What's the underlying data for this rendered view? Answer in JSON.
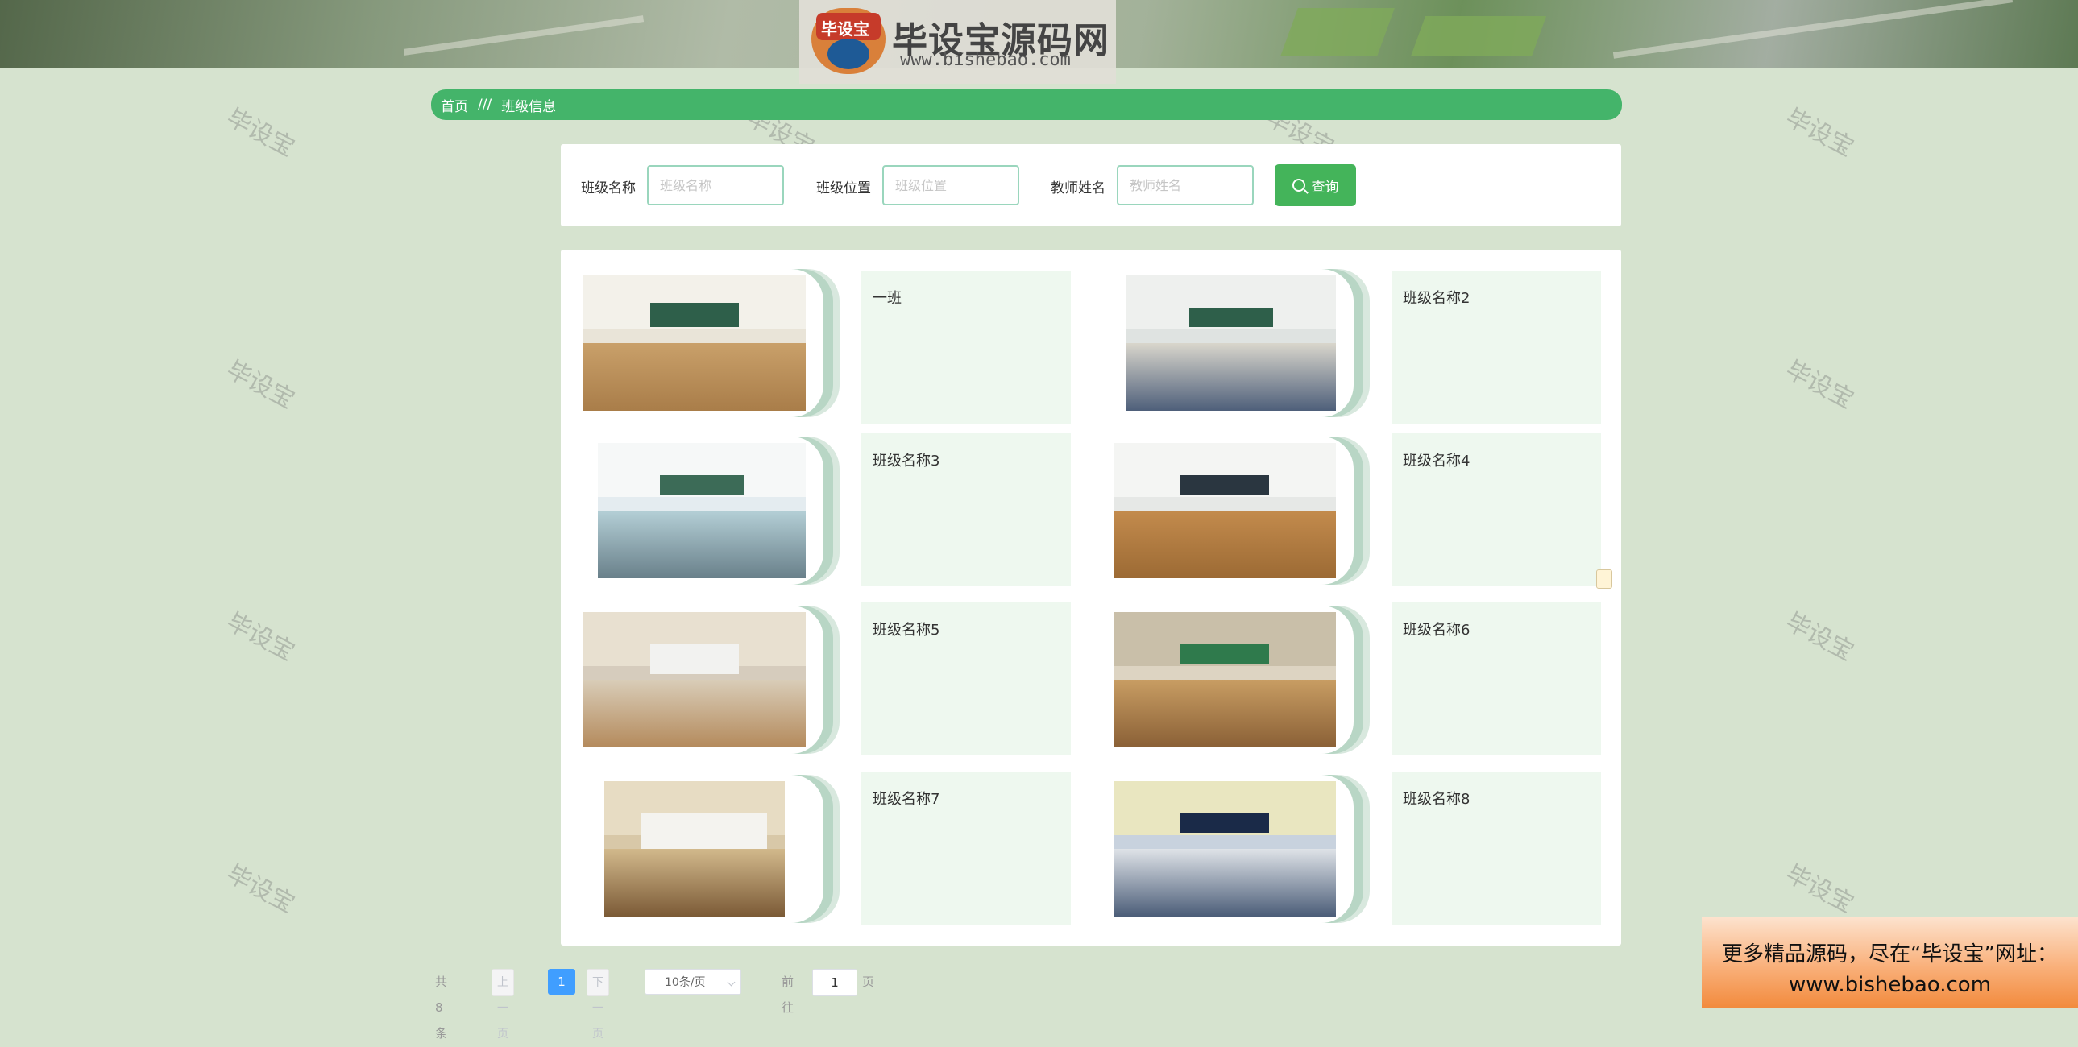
{
  "header": {
    "logo_badge": "毕设宝",
    "logo_title": "毕设宝源码网",
    "logo_url": "www.bishebao.com"
  },
  "watermark_text": "毕设宝",
  "breadcrumb": {
    "home": "首页",
    "separator": "///",
    "current": "班级信息"
  },
  "search": {
    "class_name_label": "班级名称",
    "class_name_placeholder": "班级名称",
    "class_location_label": "班级位置",
    "class_location_placeholder": "班级位置",
    "teacher_name_label": "教师姓名",
    "teacher_name_placeholder": "教师姓名",
    "query_button": "查询"
  },
  "cards": [
    {
      "name": "一班"
    },
    {
      "name": "班级名称2"
    },
    {
      "name": "班级名称3"
    },
    {
      "name": "班级名称4"
    },
    {
      "name": "班级名称5"
    },
    {
      "name": "班级名称6"
    },
    {
      "name": "班级名称7"
    },
    {
      "name": "班级名称8"
    }
  ],
  "pagination": {
    "total": "共 8 条",
    "prev": "上一页",
    "current_page": "1",
    "next": "下一页",
    "page_size": "10条/页",
    "goto_label": "前往",
    "goto_value": "1",
    "page_unit": "页"
  },
  "promo": {
    "line1": "更多精品源码，尽在“毕设宝”网址：",
    "line2": "www.bishebao.com"
  },
  "colors": {
    "accent_green": "#44b46a",
    "page_bg": "#d6e3cf",
    "card_text_bg": "#eef8ef",
    "pagination_active": "#409eff"
  }
}
